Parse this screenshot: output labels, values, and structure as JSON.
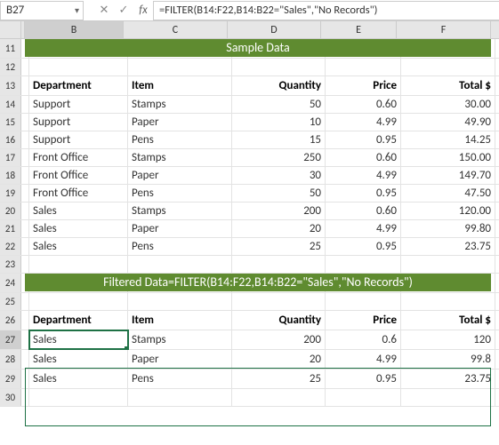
{
  "name_box": "B27",
  "formula": "=FILTER(B14:F22,B14:B22=\"Sales\",\"No Records\")",
  "columns": [
    "B",
    "C",
    "D",
    "E",
    "F"
  ],
  "banner1": "Sample Data",
  "banner2": "Filtered Data=FILTER(B14:F22,B14:B22=\"Sales\",\"No Records\")",
  "headers": {
    "dept": "Department",
    "item": "Item",
    "qty": "Quantity",
    "price": "Price",
    "total": "Total  $"
  },
  "sample": [
    {
      "dept": "Support",
      "item": "Stamps",
      "qty": "50",
      "price": "0.60",
      "total": "30.00"
    },
    {
      "dept": "Support",
      "item": "Paper",
      "qty": "10",
      "price": "4.99",
      "total": "49.90"
    },
    {
      "dept": "Support",
      "item": "Pens",
      "qty": "15",
      "price": "0.95",
      "total": "14.25"
    },
    {
      "dept": "Front Office",
      "item": "Stamps",
      "qty": "250",
      "price": "0.60",
      "total": "150.00"
    },
    {
      "dept": "Front Office",
      "item": "Paper",
      "qty": "30",
      "price": "4.99",
      "total": "149.70"
    },
    {
      "dept": "Front Office",
      "item": "Pens",
      "qty": "50",
      "price": "0.95",
      "total": "47.50"
    },
    {
      "dept": "Sales",
      "item": "Stamps",
      "qty": "200",
      "price": "0.60",
      "total": "120.00"
    },
    {
      "dept": "Sales",
      "item": "Paper",
      "qty": "20",
      "price": "4.99",
      "total": "99.80"
    },
    {
      "dept": "Sales",
      "item": "Pens",
      "qty": "25",
      "price": "0.95",
      "total": "23.75"
    }
  ],
  "filtered": [
    {
      "dept": "Sales",
      "item": "Stamps",
      "qty": "200",
      "price": "0.6",
      "total": "120"
    },
    {
      "dept": "Sales",
      "item": "Paper",
      "qty": "20",
      "price": "4.99",
      "total": "99.8"
    },
    {
      "dept": "Sales",
      "item": "Pens",
      "qty": "25",
      "price": "0.95",
      "total": "23.75"
    }
  ],
  "row_nums": {
    "r11": "11",
    "r12": "12",
    "r13": "13",
    "r14": "14",
    "r15": "15",
    "r16": "16",
    "r17": "17",
    "r18": "18",
    "r19": "19",
    "r20": "20",
    "r21": "21",
    "r22": "22",
    "r23": "23",
    "r24": "24",
    "r25": "25",
    "r26": "26",
    "r27": "27",
    "r28": "28",
    "r29": "29",
    "r30": "30"
  },
  "chart_data": {
    "type": "table",
    "title": "Sample Data with FILTER results",
    "columns": [
      "Department",
      "Item",
      "Quantity",
      "Price",
      "Total $"
    ],
    "rows": [
      [
        "Support",
        "Stamps",
        50,
        0.6,
        30.0
      ],
      [
        "Support",
        "Paper",
        10,
        4.99,
        49.9
      ],
      [
        "Support",
        "Pens",
        15,
        0.95,
        14.25
      ],
      [
        "Front Office",
        "Stamps",
        250,
        0.6,
        150.0
      ],
      [
        "Front Office",
        "Paper",
        30,
        4.99,
        149.7
      ],
      [
        "Front Office",
        "Pens",
        50,
        0.95,
        47.5
      ],
      [
        "Sales",
        "Stamps",
        200,
        0.6,
        120.0
      ],
      [
        "Sales",
        "Paper",
        20,
        4.99,
        99.8
      ],
      [
        "Sales",
        "Pens",
        25,
        0.95,
        23.75
      ]
    ]
  }
}
